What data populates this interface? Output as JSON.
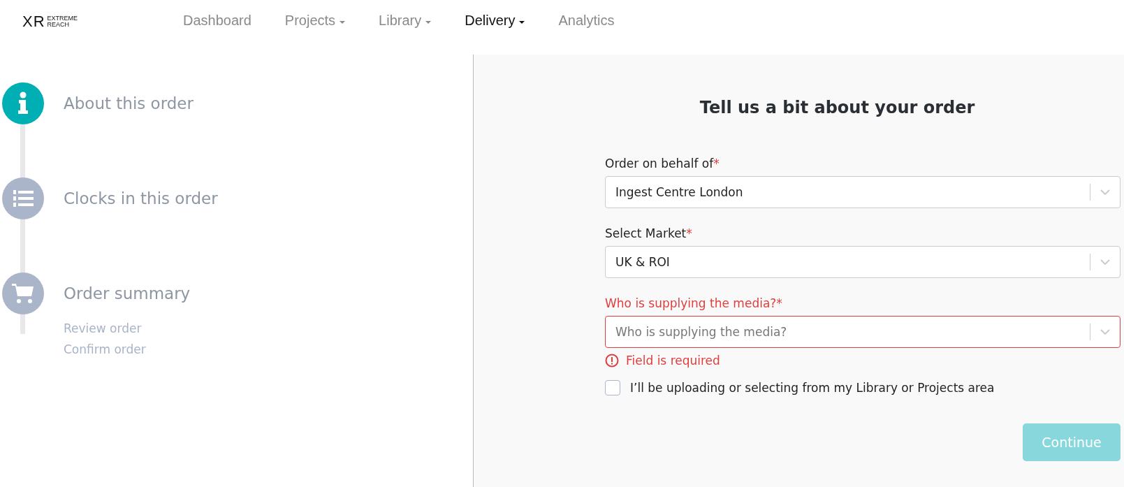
{
  "logo": {
    "mark": "XR",
    "line_1": "EXTREME",
    "line_2": "REACH"
  },
  "nav": [
    {
      "label": "Dashboard",
      "selected": false,
      "dropdown": false
    },
    {
      "label": "Projects",
      "selected": false,
      "dropdown": true
    },
    {
      "label": "Library",
      "selected": false,
      "dropdown": true
    },
    {
      "label": "Delivery",
      "selected": true,
      "dropdown": true
    },
    {
      "label": "Analytics",
      "selected": false,
      "dropdown": false
    }
  ],
  "steps": [
    {
      "label": "About this order",
      "kind": "info",
      "selected": true
    },
    {
      "label": "Clocks in this order",
      "kind": "list",
      "selected": false
    },
    {
      "label": "Order summary",
      "kind": "cart",
      "selected": false,
      "substeps": [
        "Review order",
        "Confirm order"
      ]
    }
  ],
  "form": {
    "title": "Tell us a bit about your order",
    "fields": [
      {
        "label": "Order on behalf of",
        "required_mark": "*",
        "value": "Ingest Centre London",
        "error": false
      },
      {
        "label": "Select Market",
        "required_mark": "*",
        "value": "UK & ROI",
        "error": false
      },
      {
        "label": "Who is supplying the media?",
        "required_mark": "*",
        "placeholder": "Who is supplying the media?",
        "error": true,
        "error_message": "Field is required"
      }
    ],
    "checkbox": {
      "label": "I’ll be uploading or selecting from my Library or Projects area",
      "checked": false
    },
    "continue_button": {
      "label": "Continue",
      "disabled": true
    }
  }
}
